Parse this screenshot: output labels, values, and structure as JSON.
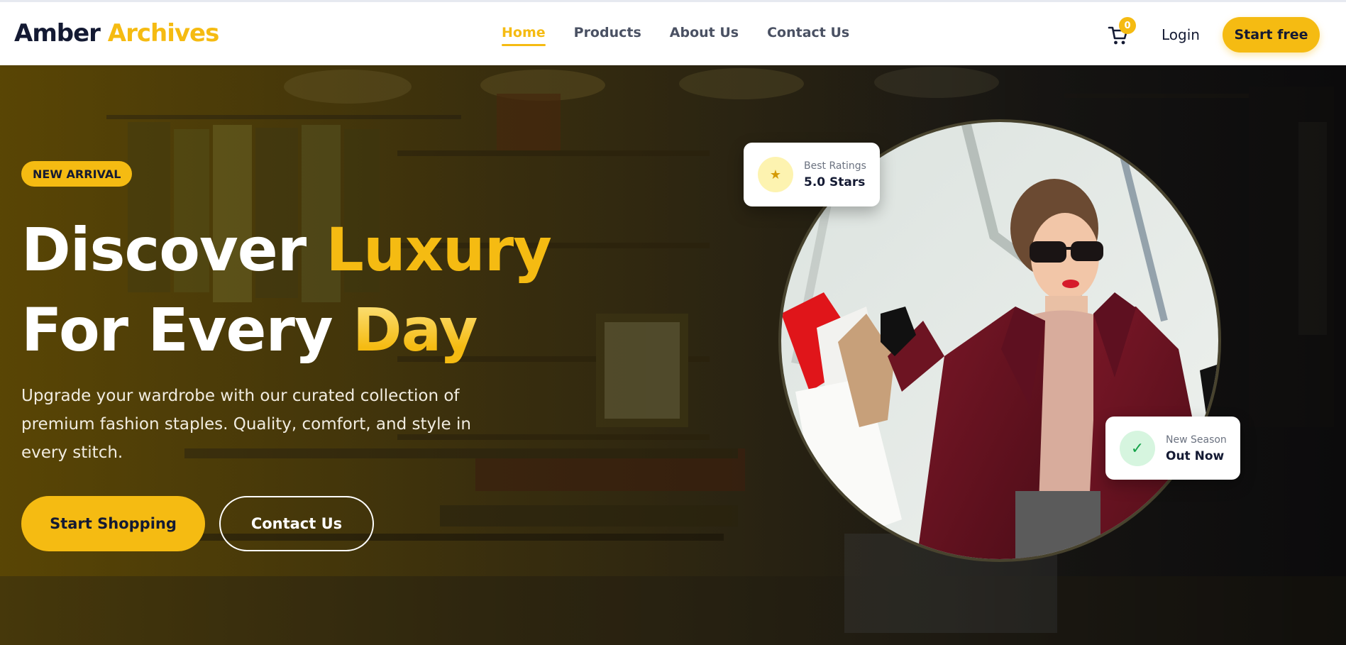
{
  "brand": {
    "name_part1": "Amber",
    "name_part2": "Archives"
  },
  "nav": {
    "links": [
      {
        "label": "Home",
        "active": true
      },
      {
        "label": "Products",
        "active": false
      },
      {
        "label": "About Us",
        "active": false
      },
      {
        "label": "Contact Us",
        "active": false
      }
    ],
    "cart_count": "0",
    "cart_icon": "cart-icon",
    "login_label": "Login",
    "cta_label": "Start free"
  },
  "hero": {
    "badge": "NEW ARRIVAL",
    "headline_line1_white": "Discover ",
    "headline_line1_accent": "Luxury",
    "headline_line2_white": "For Every ",
    "headline_line2_accent": "Day",
    "subtext": "Upgrade your wardrobe with our curated collection of premium fashion staples. Quality, comfort, and style in every stitch.",
    "primary_button": "Start Shopping",
    "secondary_button": "Contact Us"
  },
  "cards": {
    "ratings": {
      "icon": "star-icon",
      "glyph": "★",
      "label": "Best Ratings",
      "value": "5.0 Stars"
    },
    "season": {
      "icon": "check-icon",
      "glyph": "✓",
      "label": "New Season",
      "value": "Out Now"
    }
  },
  "colors": {
    "accent": "#f5bb12",
    "navy": "#141a33",
    "nav_text": "#4a5163",
    "white": "#ffffff"
  }
}
